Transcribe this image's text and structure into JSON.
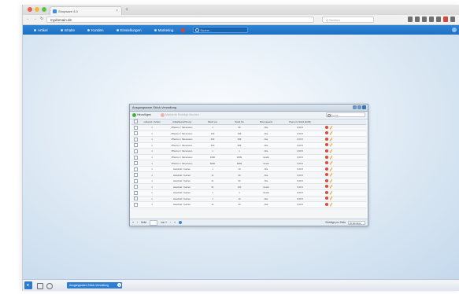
{
  "browser": {
    "tab_title": "Shopware 4.0",
    "new_tab": "+",
    "url": "mydomain.de",
    "search_placeholder": "Q Suchen",
    "nav": [
      "←",
      "→",
      "↻"
    ]
  },
  "app_menu": {
    "items": [
      "Artikel",
      "Inhalte",
      "Kunden",
      "Einstellungen",
      "Marketing"
    ],
    "search_placeholder": "Suche..."
  },
  "window": {
    "title": "Ausgangsware-Stück-Verwaltung",
    "toolbar": {
      "add_label": "Hinzufügen",
      "delete_label": "Markierte Einträge löschen",
      "search_placeholder": "Suche..."
    },
    "columns": [
      "Lieferant / Artikel",
      "Artikelbezeichnung",
      "Stück von",
      "Stück bis",
      "Preis gesamt",
      "Preis pro Stück (EUR)"
    ],
    "rows": [
      [
        "1",
        "Pflanzen / Sämereien",
        "1",
        "99",
        "Alle",
        "0,00 €"
      ],
      [
        "1",
        "Pflanzen / Sämereien",
        "100",
        "199",
        "Alle",
        "0,00 €"
      ],
      [
        "1",
        "Pflanzen / Sämereien",
        "200",
        "299",
        "Alle",
        "0,00 €"
      ],
      [
        "1",
        "Pflanzen / Sämereien",
        "300",
        "999",
        "Alle",
        "0,00 €"
      ],
      [
        "1",
        "Pflanzen / Sämereien",
        "1",
        "1",
        "Alle",
        "0,00 €"
      ],
      [
        "1",
        "Pflanzen / Sämereien",
        "1000",
        "4999",
        "Gratis",
        "0,00 €"
      ],
      [
        "1",
        "Pflanzen / Sämereien",
        "5000",
        "9999",
        "Gratis",
        "0,00 €"
      ],
      [
        "1",
        "Haushalt / Garten",
        "1",
        "10",
        "Alle",
        "0,00 €"
      ],
      [
        "1",
        "Haushalt / Garten",
        "11",
        "20",
        "Alle",
        "0,00 €"
      ],
      [
        "1",
        "Haushalt / Garten",
        "21",
        "50",
        "Alle",
        "0,00 €"
      ],
      [
        "1",
        "Haushalt / Garten",
        "51",
        "100",
        "Gratis",
        "0,00 €"
      ],
      [
        "1",
        "Haushalt / Garten",
        "1",
        "1",
        "Gratis",
        "0,00 €"
      ],
      [
        "1",
        "Haushalt / Garten",
        "1",
        "10",
        "Alle",
        "0,00 €"
      ],
      [
        "1",
        "Haushalt / Garten",
        "11",
        "20",
        "Alle",
        "0,00 €"
      ]
    ],
    "pager": {
      "page_label": "Seite",
      "of_label": "von 1",
      "entries_label": "Einträge pro Seite",
      "per_page": "20 Einträge"
    }
  },
  "taskbar": {
    "task_label": "Ausgangsware-Stück-Verwaltung",
    "badge": "1"
  },
  "colors": {
    "accent": "#2a7ad0",
    "menu_bar": "#1f6fc0",
    "delete": "#e0483a",
    "edit": "#f09a1c"
  }
}
